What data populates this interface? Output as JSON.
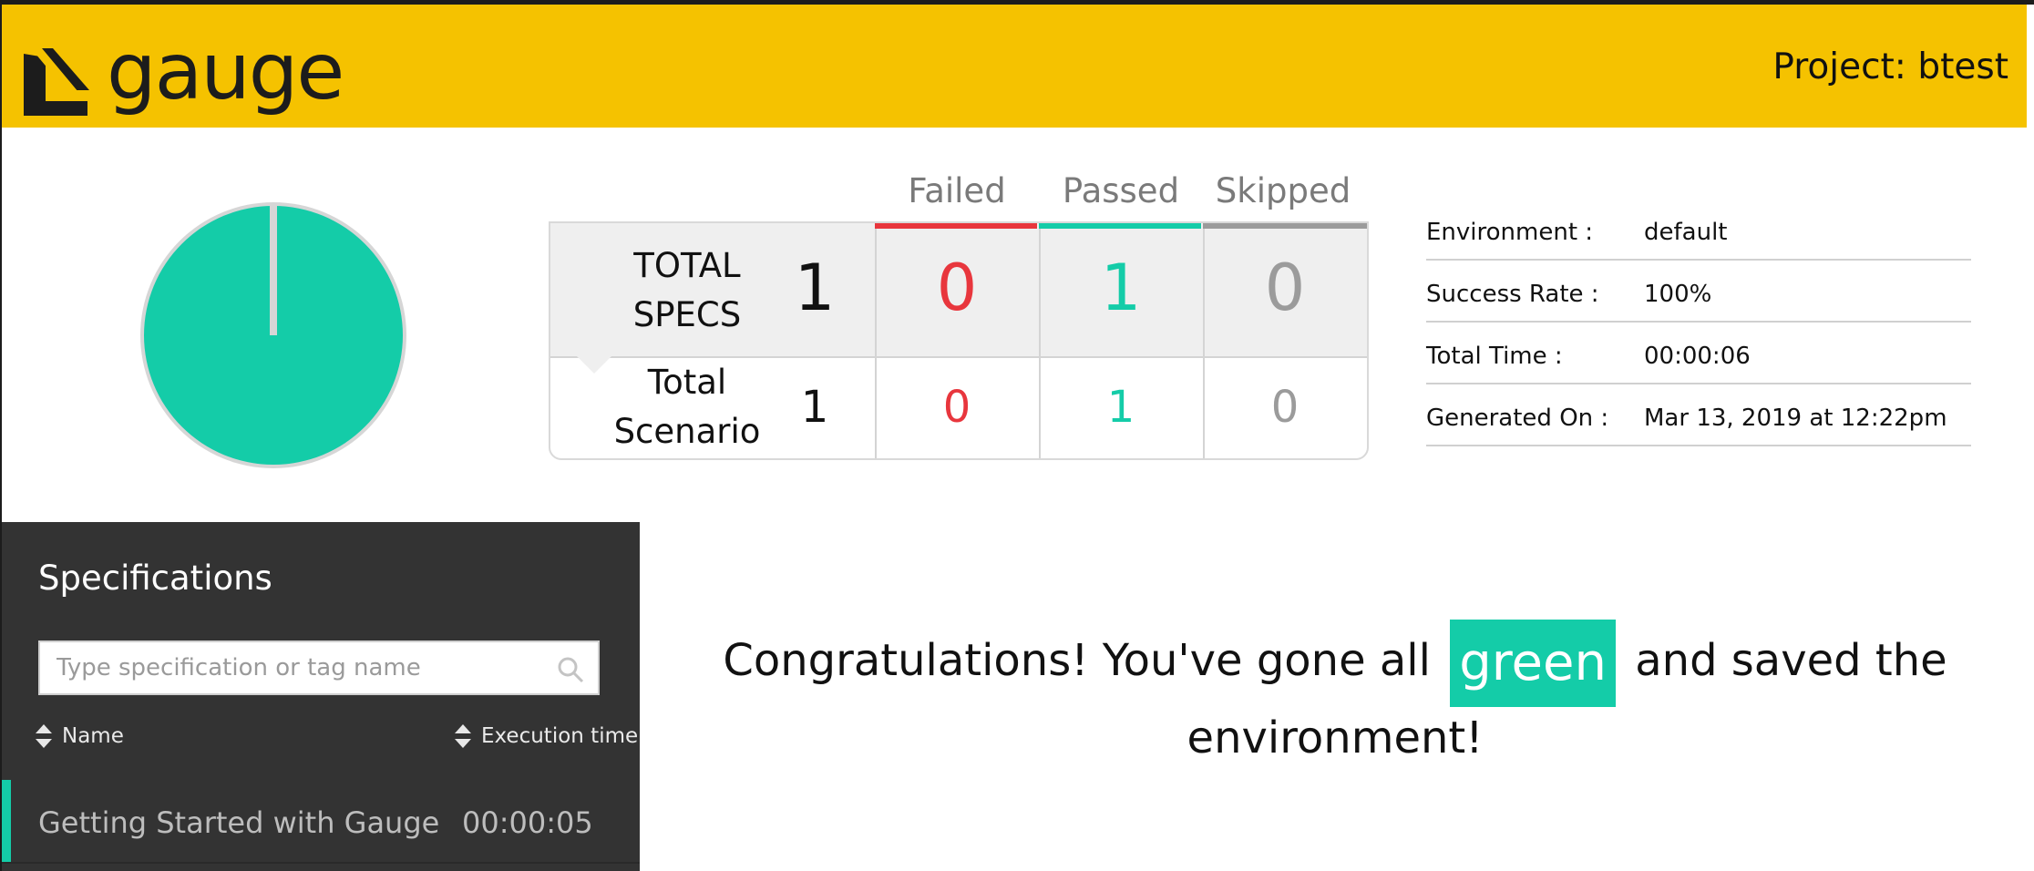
{
  "header": {
    "logo_text": "gauge",
    "project_label": "Project: btest",
    "brand_color": "#f5c200"
  },
  "summary": {
    "pie": {
      "passed": 1,
      "failed": 0,
      "skipped": 0,
      "pass_color": "#14cca8"
    },
    "columns": {
      "failed": "Failed",
      "passed": "Passed",
      "skipped": "Skipped"
    },
    "column_colors": {
      "failed": "#e8363d",
      "passed": "#14cca8",
      "skipped": "#9b9b9b"
    },
    "specs": {
      "label_line1": "TOTAL",
      "label_line2": "SPECS",
      "total": "1",
      "failed": "0",
      "passed": "1",
      "skipped": "0"
    },
    "scenarios": {
      "label_line1": "Total",
      "label_line2": "Scenario",
      "total": "1",
      "failed": "0",
      "passed": "1",
      "skipped": "0"
    }
  },
  "info": [
    {
      "key": "Environment :",
      "value": "default"
    },
    {
      "key": "Success Rate :",
      "value": "100%"
    },
    {
      "key": "Total Time :",
      "value": "00:00:06"
    },
    {
      "key": "Generated On :",
      "value": "Mar 13, 2019 at 12:22pm"
    }
  ],
  "sidebar": {
    "title": "Specifications",
    "search_placeholder": "Type specification or tag name",
    "sort_name": "Name",
    "sort_time": "Execution time",
    "specs": [
      {
        "name": "Getting Started with Gauge",
        "time": "00:00:05"
      }
    ]
  },
  "message": {
    "before": "Congratulations! You've gone all",
    "highlight": "green",
    "after": "and saved the environment!"
  }
}
